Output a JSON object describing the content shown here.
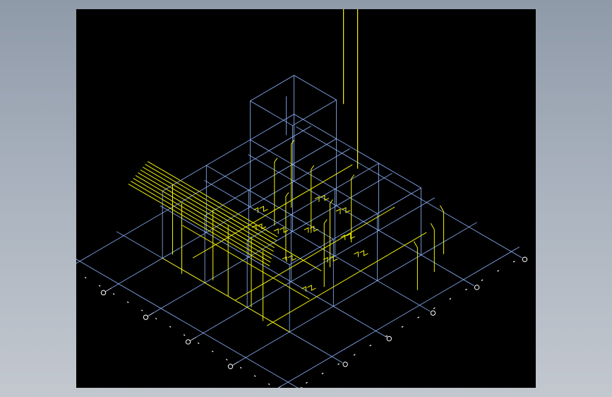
{
  "canvas": {
    "background": "#000000",
    "page_background": "#a3adba"
  },
  "colors": {
    "grid": "#8fb6ff",
    "piping": "#f2f20a",
    "markers": "#ffffff"
  },
  "axis_bubbles": {
    "count_left_axis": 6,
    "count_right_axis": 6
  }
}
